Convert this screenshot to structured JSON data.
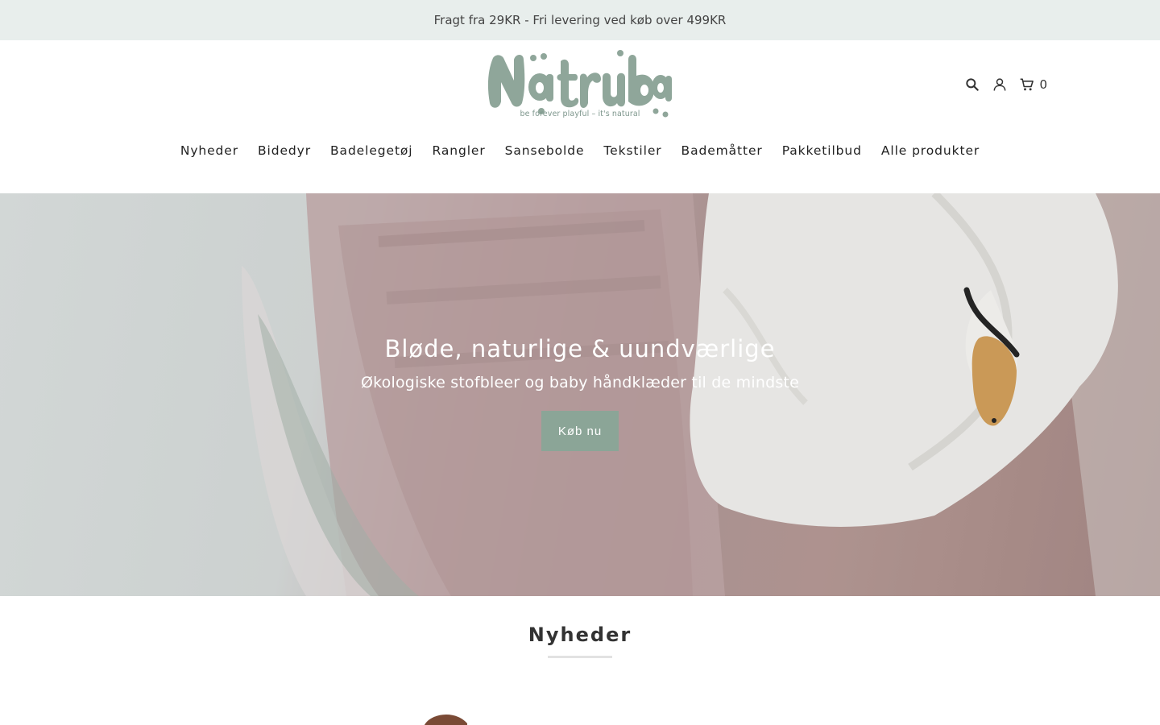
{
  "announcement": {
    "text": "Fragt fra 29KR - Fri levering ved køb over 499KR"
  },
  "header": {
    "logo": {
      "wordmark": "Natruba",
      "tagline": "be forever playful – it's natural"
    },
    "icons": [
      "search-icon",
      "account-icon",
      "cart-icon"
    ],
    "cart_count": "0"
  },
  "nav": {
    "items": [
      {
        "label": "Nyheder"
      },
      {
        "label": "Bidedyr"
      },
      {
        "label": "Badelegetøj"
      },
      {
        "label": "Rangler"
      },
      {
        "label": "Sansebolde"
      },
      {
        "label": "Tekstiler"
      },
      {
        "label": "Bademåtter"
      },
      {
        "label": "Pakketilbud"
      },
      {
        "label": "Alle produkter"
      }
    ]
  },
  "hero": {
    "title": "Bløde, naturlige & uundværlige",
    "subtitle": "Økologiske stofbleer og baby håndklæder til de mindste",
    "button_label": "Køb nu"
  },
  "section": {
    "title": "Nyheder"
  },
  "colors": {
    "accent": "#8ba597",
    "announce_bg": "#e8eeec",
    "logo": "#8fa69a"
  }
}
